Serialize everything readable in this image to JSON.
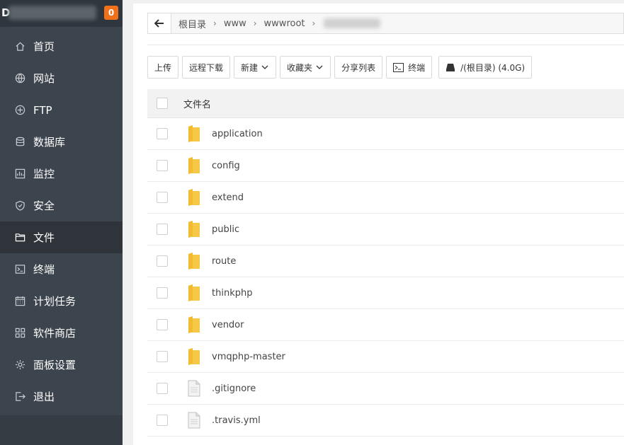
{
  "sidebar": {
    "logo_letter": "D",
    "badge": "0",
    "items": [
      {
        "label": "首页",
        "icon": "home-icon"
      },
      {
        "label": "网站",
        "icon": "globe-icon"
      },
      {
        "label": "FTP",
        "icon": "ftp-icon"
      },
      {
        "label": "数据库",
        "icon": "database-icon"
      },
      {
        "label": "监控",
        "icon": "monitor-icon"
      },
      {
        "label": "安全",
        "icon": "shield-icon"
      },
      {
        "label": "文件",
        "icon": "folder-icon",
        "active": true
      },
      {
        "label": "终端",
        "icon": "terminal-icon"
      },
      {
        "label": "计划任务",
        "icon": "calendar-icon"
      },
      {
        "label": "软件商店",
        "icon": "apps-icon"
      },
      {
        "label": "面板设置",
        "icon": "gear-icon"
      },
      {
        "label": "退出",
        "icon": "logout-icon"
      }
    ]
  },
  "pathbar": {
    "crumbs": [
      "根目录",
      "www",
      "wwwroot"
    ]
  },
  "toolbar": {
    "upload": "上传",
    "remote_download": "远程下载",
    "new": "新建",
    "favorites": "收藏夹",
    "share_list": "分享列表",
    "terminal": "终端",
    "disk": "/(根目录) (4.0G)"
  },
  "table": {
    "header": "文件名",
    "rows": [
      {
        "name": "application",
        "type": "folder"
      },
      {
        "name": "config",
        "type": "folder"
      },
      {
        "name": "extend",
        "type": "folder"
      },
      {
        "name": "public",
        "type": "folder"
      },
      {
        "name": "route",
        "type": "folder"
      },
      {
        "name": "thinkphp",
        "type": "folder"
      },
      {
        "name": "vendor",
        "type": "folder"
      },
      {
        "name": "vmqphp-master",
        "type": "folder"
      },
      {
        "name": ".gitignore",
        "type": "file"
      },
      {
        "name": ".travis.yml",
        "type": "file"
      }
    ]
  },
  "colors": {
    "sidebar_bg": "#3c444d",
    "active_item": "#2f343a",
    "badge": "#f0711a",
    "folder": "#f6c846"
  }
}
